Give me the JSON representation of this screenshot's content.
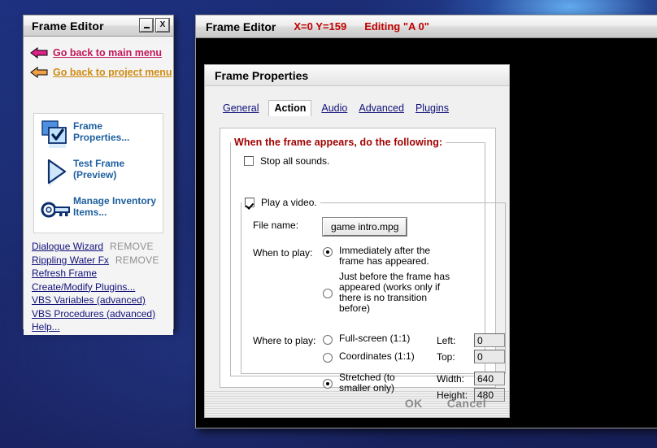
{
  "desktop": {
    "background_color": "#1b2a6e",
    "accent_color": "#6ebeff"
  },
  "sidebar": {
    "title": "Frame Editor",
    "window_buttons": [
      {
        "name": "minimize",
        "label": "_"
      },
      {
        "name": "close",
        "label": "X"
      }
    ],
    "nav_links": [
      {
        "label": "Go back to main menu",
        "color": "#c2185b",
        "arrow_color": "#e0218a"
      },
      {
        "label": "Go back to project menu",
        "color": "#cf8b13",
        "arrow_color": "#f0a045"
      }
    ],
    "actions": [
      {
        "label": "Frame Properties...",
        "icon": "checkbox-square-icon"
      },
      {
        "label": "Test Frame (Preview)",
        "icon": "play-triangle-icon"
      },
      {
        "label": "Manage Inventory Items...",
        "icon": "key-icon"
      }
    ],
    "links": [
      {
        "label": "Dialogue Wizard",
        "remove": "REMOVE"
      },
      {
        "label": "Rippling Water Fx",
        "remove": "REMOVE"
      },
      {
        "label": "Refresh Frame",
        "remove": ""
      },
      {
        "label": "Create/Modify Plugins...",
        "remove": ""
      },
      {
        "label": "VBS Variables (advanced)",
        "remove": ""
      },
      {
        "label": "VBS Procedures (advanced)",
        "remove": ""
      },
      {
        "label": "Help...",
        "remove": ""
      }
    ]
  },
  "editor": {
    "title": "Frame Editor",
    "coordinates": "X=0 Y=159",
    "editing": "Editing \"A 0\"",
    "status_color": "#c00000"
  },
  "dialog": {
    "title": "Frame Properties",
    "tabs": [
      {
        "label": "General",
        "active": false
      },
      {
        "label": "Action",
        "active": true
      },
      {
        "label": "Audio",
        "active": false
      },
      {
        "label": "Advanced",
        "active": false
      },
      {
        "label": "Plugins",
        "active": false
      }
    ],
    "group_legend": "When the frame appears, do the following:",
    "stop_sounds": {
      "label": "Stop all sounds.",
      "checked": false
    },
    "play_video": {
      "label": "Play a video.",
      "checked": true
    },
    "file_name_label": "File name:",
    "file_name_value": "game intro.mpg",
    "when_to_play_label": "When to play:",
    "when_to_play_options": [
      {
        "label": "Immediately after the frame has appeared.",
        "checked": true
      },
      {
        "label": "Just before the frame has appeared (works only if there is no transition before)",
        "checked": false
      }
    ],
    "where_to_play_label": "Where to play:",
    "where_to_play_options": [
      {
        "label": "Full-screen (1:1)",
        "checked": false
      },
      {
        "label": "Coordinates (1:1)",
        "checked": false
      },
      {
        "label": "Stretched (to smaller only)",
        "checked": true
      }
    ],
    "coordinates": [
      {
        "label": "Left:",
        "value": "0"
      },
      {
        "label": "Top:",
        "value": "0"
      },
      {
        "label": "Width:",
        "value": "640"
      },
      {
        "label": "Height:",
        "value": "480"
      }
    ],
    "ok_label": "OK",
    "cancel_label": "Cancel"
  }
}
